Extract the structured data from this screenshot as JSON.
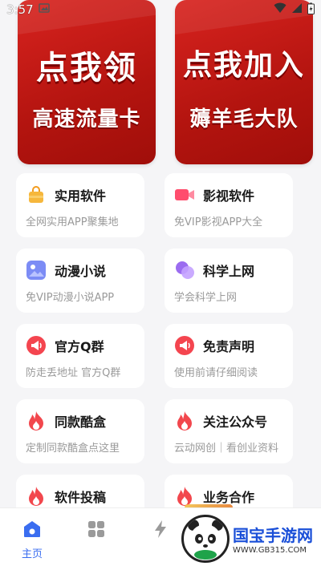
{
  "status_bar": {
    "time": "3:57"
  },
  "banners": [
    {
      "line1": "点我领",
      "line2": "高速流量卡"
    },
    {
      "line1": "点我加入",
      "line2": "薅羊毛大队"
    }
  ],
  "cards": [
    {
      "title": "实用软件",
      "subtitle": "全网实用APP聚集地",
      "icon": "bag-icon",
      "color": "#f6b73c"
    },
    {
      "title": "影视软件",
      "subtitle": "免VIP影视APP大全",
      "icon": "video-icon",
      "color": "#ff5a7a"
    },
    {
      "title": "动漫小说",
      "subtitle": "免VIP动漫小说APP",
      "icon": "image-icon",
      "color": "#7c8cf5"
    },
    {
      "title": "科学上网",
      "subtitle": "学会科学上网",
      "icon": "bubbles-icon",
      "color": "#a06cf0"
    },
    {
      "title": "官方Q群",
      "subtitle": "防走丢地址 官方Q群",
      "icon": "megaphone-icon",
      "color": "#f4454f"
    },
    {
      "title": "免责声明",
      "subtitle": "使用前请仔细阅读",
      "icon": "megaphone-icon",
      "color": "#f4454f"
    },
    {
      "title": "同款酷盒",
      "subtitle": "定制同款酷盒点这里",
      "icon": "flame-icon",
      "color": "#f2474d"
    },
    {
      "title": "关注公众号",
      "subtitle": "云动网创｜看创业资料",
      "icon": "flame-icon",
      "color": "#f2474d"
    },
    {
      "title": "软件投稿",
      "subtitle": "",
      "icon": "flame-icon",
      "color": "#f2474d"
    },
    {
      "title": "业务合作",
      "subtitle": "",
      "icon": "flame-icon",
      "color": "#f2474d"
    }
  ],
  "bottom_nav": [
    {
      "label": "主页",
      "icon": "home-icon",
      "active": true
    },
    {
      "label": "",
      "icon": "grid-icon",
      "active": false
    },
    {
      "label": "",
      "icon": "bolt-icon",
      "active": false
    }
  ],
  "watermark": {
    "name": "国宝手游网",
    "url": "WWW.GB315.COM"
  }
}
